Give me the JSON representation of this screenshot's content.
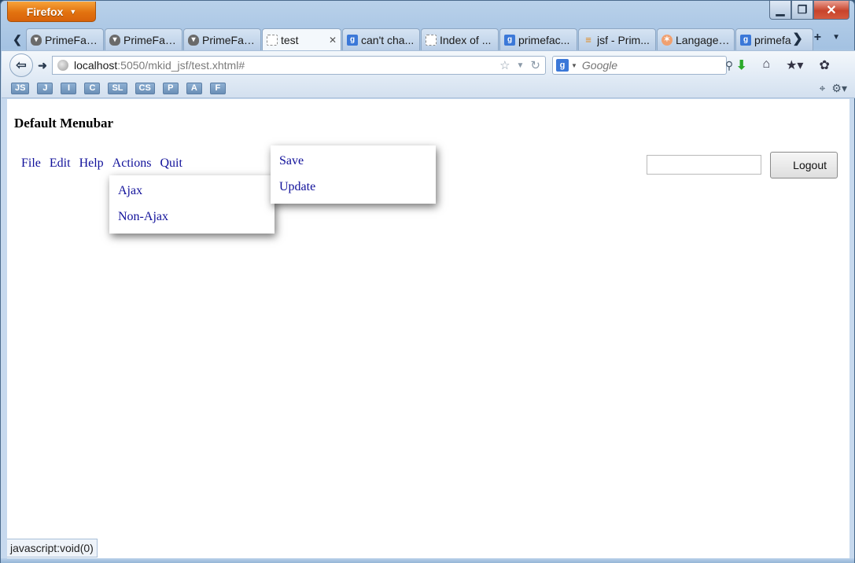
{
  "browser": {
    "app_button": "Firefox",
    "window_controls": {
      "minimize": "▁",
      "maximize": "❐",
      "close": "✕"
    }
  },
  "tabs": [
    {
      "label": "PrimeFac...",
      "favicon": "primefaces-icon",
      "active": false
    },
    {
      "label": "PrimeFac...",
      "favicon": "primefaces-icon",
      "active": false
    },
    {
      "label": "PrimeFac...",
      "favicon": "primefaces-icon",
      "active": false
    },
    {
      "label": "test",
      "favicon": "blank-page-icon",
      "active": true
    },
    {
      "label": "can't cha...",
      "favicon": "google-icon",
      "active": false
    },
    {
      "label": "Index of ...",
      "favicon": "blank-page-icon",
      "active": false
    },
    {
      "label": "primefac...",
      "favicon": "google-icon",
      "active": false
    },
    {
      "label": "jsf - Prim...",
      "favicon": "stackoverflow-icon",
      "active": false
    },
    {
      "label": "Langage ...",
      "favicon": "langage-icon",
      "active": false
    },
    {
      "label": "primefa",
      "favicon": "google-icon",
      "active": false
    }
  ],
  "navbar": {
    "url_host": "localhost",
    "url_rest": ":5050/mkid_jsf/test.xhtml#",
    "search_placeholder": "Google"
  },
  "bookmarks": [
    "JS",
    "J",
    "I",
    "C",
    "SL",
    "CS",
    "P",
    "A",
    "F"
  ],
  "page": {
    "title": "Default Menubar",
    "menubar": [
      "File",
      "Edit",
      "Help",
      "Actions",
      "Quit"
    ],
    "file_submenu": [
      "Save",
      "Update"
    ],
    "actions_submenu": [
      "Ajax",
      "Non-Ajax"
    ],
    "logout_label": "Logout",
    "logout_input_value": ""
  },
  "status": "javascript:void(0)"
}
